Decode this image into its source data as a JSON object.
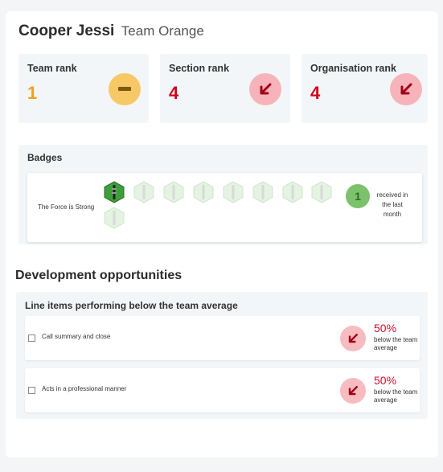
{
  "header": {
    "name": "Cooper Jessi",
    "team": "Team Orange"
  },
  "ranks": [
    {
      "label": "Team rank",
      "value": "1",
      "color": "#f0a020",
      "circle_color": "#f6c866",
      "trend": "neutral",
      "icon": "dash-icon"
    },
    {
      "label": "Section rank",
      "value": "4",
      "color": "#d0021b",
      "circle_color": "#f6b4ba",
      "trend": "down",
      "icon": "arrow-down-left-icon"
    },
    {
      "label": "Organisation rank",
      "value": "4",
      "color": "#d0021b",
      "circle_color": "#f6b4ba",
      "trend": "down",
      "icon": "arrow-down-left-icon"
    }
  ],
  "badges": {
    "title": "Badges",
    "badge_name": "The Force is Strong",
    "earned_badge_icon": "lightsaber-icon",
    "locked_badge_icon": "lightsaber-icon",
    "earned_count": 1,
    "locked_count": 8,
    "received_count": "1",
    "received_label": "received in the last month"
  },
  "development": {
    "title": "Development opportunities",
    "subtitle": "Line items performing below the team average",
    "items": [
      {
        "label": "Call summary and close",
        "percent": "50%",
        "description": "below the team average",
        "icon": "arrow-down-left-icon"
      },
      {
        "label": "Acts in a professional manner",
        "percent": "50%",
        "description": "below the team average",
        "icon": "arrow-down-left-icon"
      }
    ]
  }
}
